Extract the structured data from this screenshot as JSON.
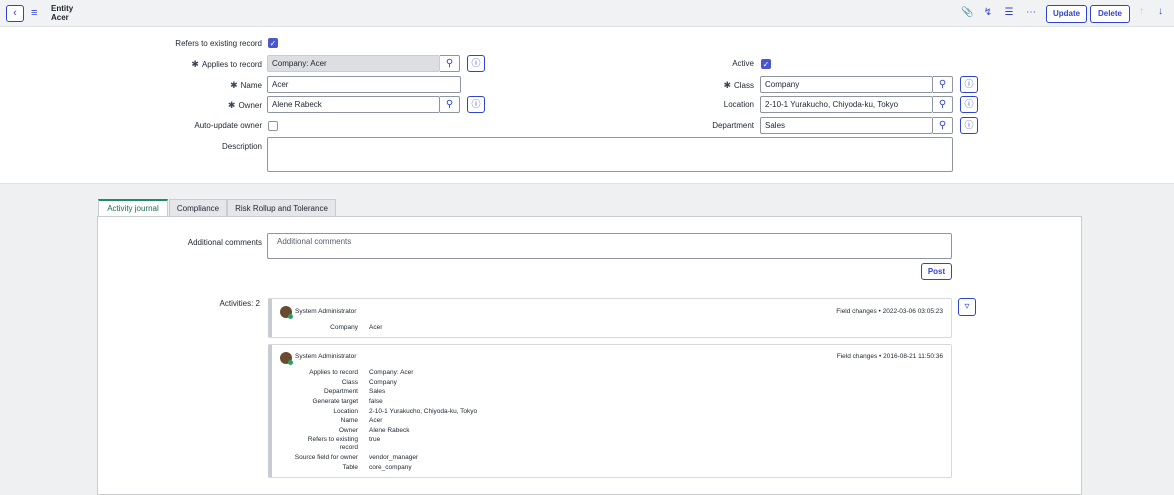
{
  "header": {
    "title": "Entity",
    "subtitle": "Acer",
    "update_label": "Update",
    "delete_label": "Delete",
    "icons": [
      "back-icon",
      "menu-icon",
      "paperclip-icon",
      "activity-icon",
      "settings-sliders-icon",
      "more-icon",
      "arrow-up-icon",
      "arrow-down-icon"
    ]
  },
  "form": {
    "refers_label": "Refers to existing record",
    "applies_label": "Applies to record",
    "applies_value": "Company: Acer",
    "name_label": "Name",
    "name_value": "Acer",
    "owner_label": "Owner",
    "owner_value": "Alene Rabeck",
    "auto_update_label": "Auto-update owner",
    "description_label": "Description",
    "active_label": "Active",
    "class_label": "Class",
    "class_value": "Company",
    "location_label": "Location",
    "location_value": "2-10-1 Yurakucho, Chiyoda-ku, Tokyo",
    "department_label": "Department",
    "department_value": "Sales",
    "required_mark": "✱"
  },
  "tabs": [
    "Activity journal",
    "Compliance",
    "Risk Rollup and Tolerance"
  ],
  "journal": {
    "comments_label": "Additional comments",
    "comments_placeholder": "Additional comments",
    "post_label": "Post",
    "activities_label": "Activities: 2"
  },
  "activities": [
    {
      "user": "System Administrator",
      "meta": "Field changes  •  2022-03-06 03:05:23",
      "fields": [
        {
          "key": "Company",
          "value": "Acer"
        }
      ]
    },
    {
      "user": "System Administrator",
      "meta": "Field changes  •  2016-08-21 11:50:36",
      "fields": [
        {
          "key": "Applies to record",
          "value": "Company: Acer"
        },
        {
          "key": "Class",
          "value": "Company"
        },
        {
          "key": "Department",
          "value": "Sales"
        },
        {
          "key": "Generate target",
          "value": "false"
        },
        {
          "key": "Location",
          "value": "2-10-1 Yurakucho, Chiyoda-ku, Tokyo"
        },
        {
          "key": "Name",
          "value": "Acer"
        },
        {
          "key": "Owner",
          "value": "Alene Rabeck"
        },
        {
          "key": "Refers to existing",
          "key2": "record",
          "value": "true"
        },
        {
          "key": "Source field for owner",
          "value": "vendor_manager"
        },
        {
          "key": "Table",
          "value": "core_company"
        }
      ]
    }
  ],
  "colors": {
    "accent": "#2f44d2",
    "tab_active": "#1f8a66",
    "checkbox": "#4b58c9"
  }
}
